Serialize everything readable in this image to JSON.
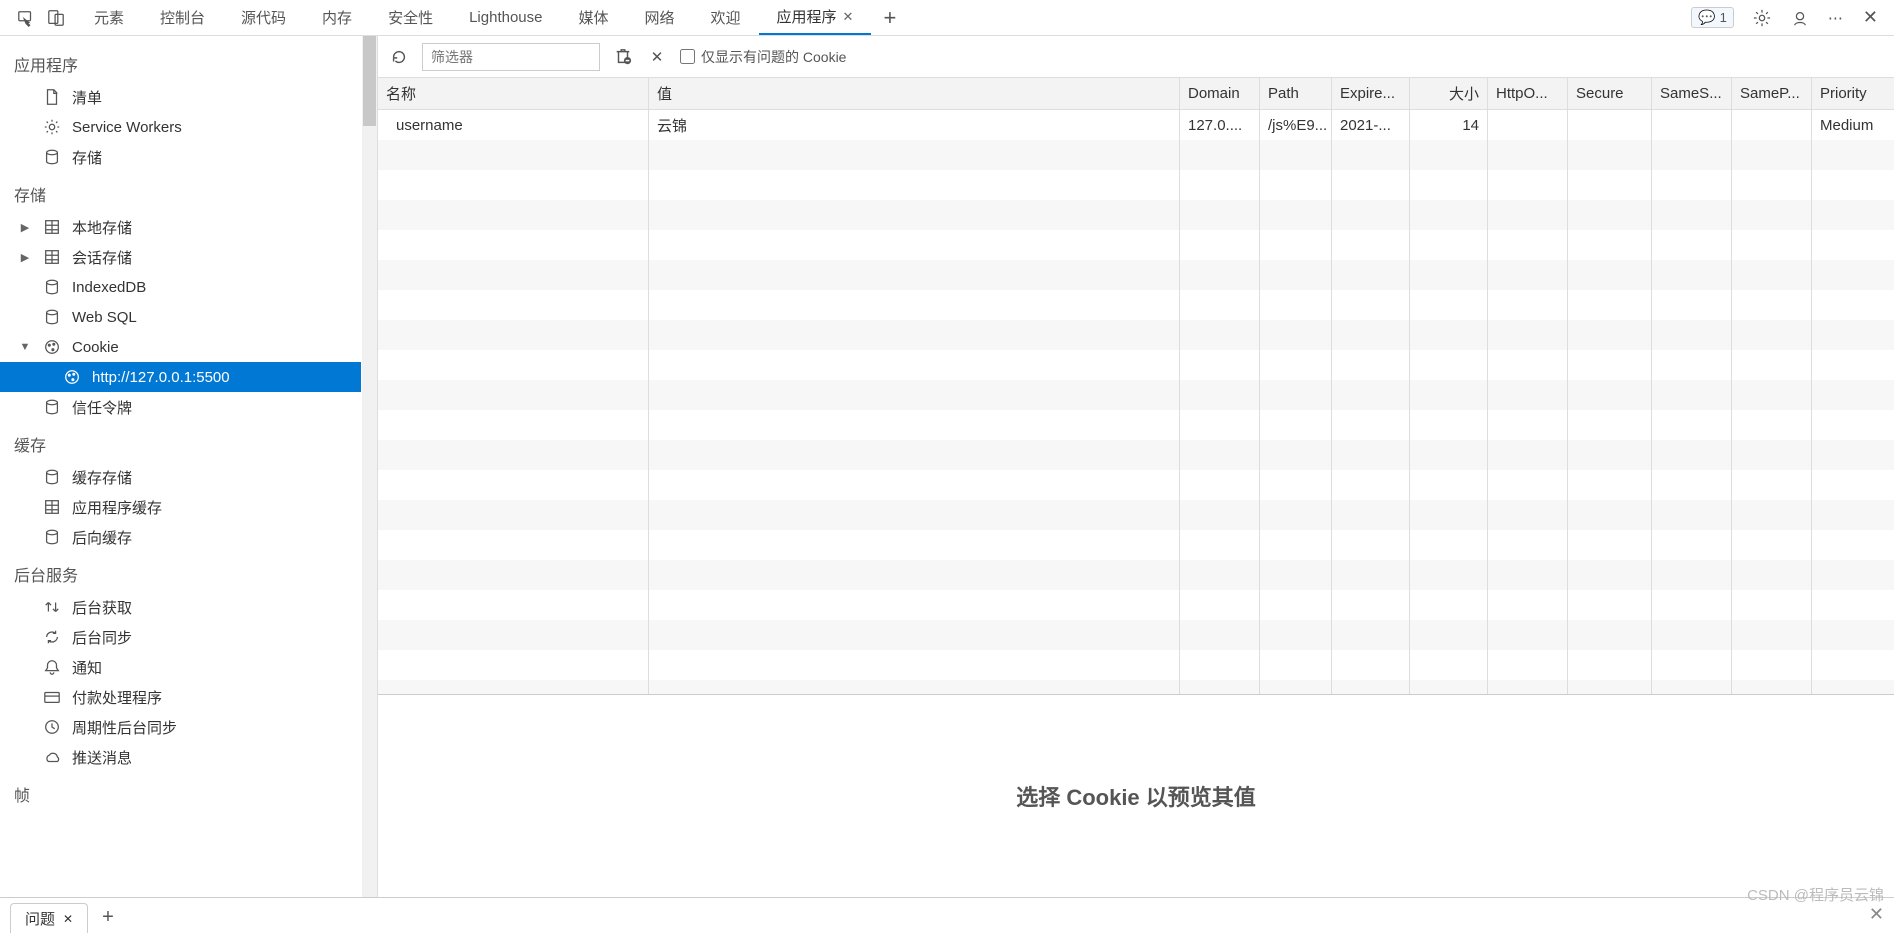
{
  "topbar": {
    "tabs": [
      "元素",
      "控制台",
      "源代码",
      "内存",
      "安全性",
      "Lighthouse",
      "媒体",
      "网络",
      "欢迎",
      "应用程序"
    ],
    "active_index": 9,
    "badge_count": "1"
  },
  "sidebar": {
    "sections": [
      {
        "title": "应用程序",
        "items": [
          {
            "icon": "file",
            "label": "清单"
          },
          {
            "icon": "gear",
            "label": "Service Workers"
          },
          {
            "icon": "db",
            "label": "存储"
          }
        ]
      },
      {
        "title": "存储",
        "items": [
          {
            "icon": "grid",
            "label": "本地存储",
            "exp": "▶"
          },
          {
            "icon": "grid",
            "label": "会话存储",
            "exp": "▶"
          },
          {
            "icon": "db",
            "label": "IndexedDB"
          },
          {
            "icon": "db",
            "label": "Web SQL"
          },
          {
            "icon": "cookie",
            "label": "Cookie",
            "exp": "▼",
            "children": [
              {
                "icon": "cookie",
                "label": "http://127.0.0.1:5500",
                "selected": true
              }
            ]
          },
          {
            "icon": "db",
            "label": "信任令牌"
          }
        ]
      },
      {
        "title": "缓存",
        "items": [
          {
            "icon": "db",
            "label": "缓存存储"
          },
          {
            "icon": "grid",
            "label": "应用程序缓存"
          },
          {
            "icon": "db",
            "label": "后向缓存"
          }
        ]
      },
      {
        "title": "后台服务",
        "items": [
          {
            "icon": "updown",
            "label": "后台获取"
          },
          {
            "icon": "sync",
            "label": "后台同步"
          },
          {
            "icon": "bell",
            "label": "通知"
          },
          {
            "icon": "card",
            "label": "付款处理程序"
          },
          {
            "icon": "clock",
            "label": "周期性后台同步"
          },
          {
            "icon": "cloud",
            "label": "推送消息"
          }
        ]
      },
      {
        "title": "帧"
      }
    ]
  },
  "toolbar": {
    "filter_placeholder": "筛选器",
    "only_issues_label": "仅显示有问题的 Cookie"
  },
  "table": {
    "headers": {
      "name": "名称",
      "value": "值",
      "domain": "Domain",
      "path": "Path",
      "expires": "Expire...",
      "size": "大小",
      "httponly": "HttpO...",
      "secure": "Secure",
      "samesite": "SameS...",
      "sameparty": "SameP...",
      "priority": "Priority"
    },
    "rows": [
      {
        "name": "username",
        "value": "云锦",
        "domain": "127.0....",
        "path": "/js%E9...",
        "expires": "2021-...",
        "size": "14",
        "httponly": "",
        "secure": "",
        "samesite": "",
        "sameparty": "",
        "priority": "Medium"
      }
    ]
  },
  "preview": {
    "message": "选择 Cookie 以预览其值"
  },
  "bottom": {
    "tab_label": "问题"
  },
  "watermark": "CSDN @程序员云锦"
}
